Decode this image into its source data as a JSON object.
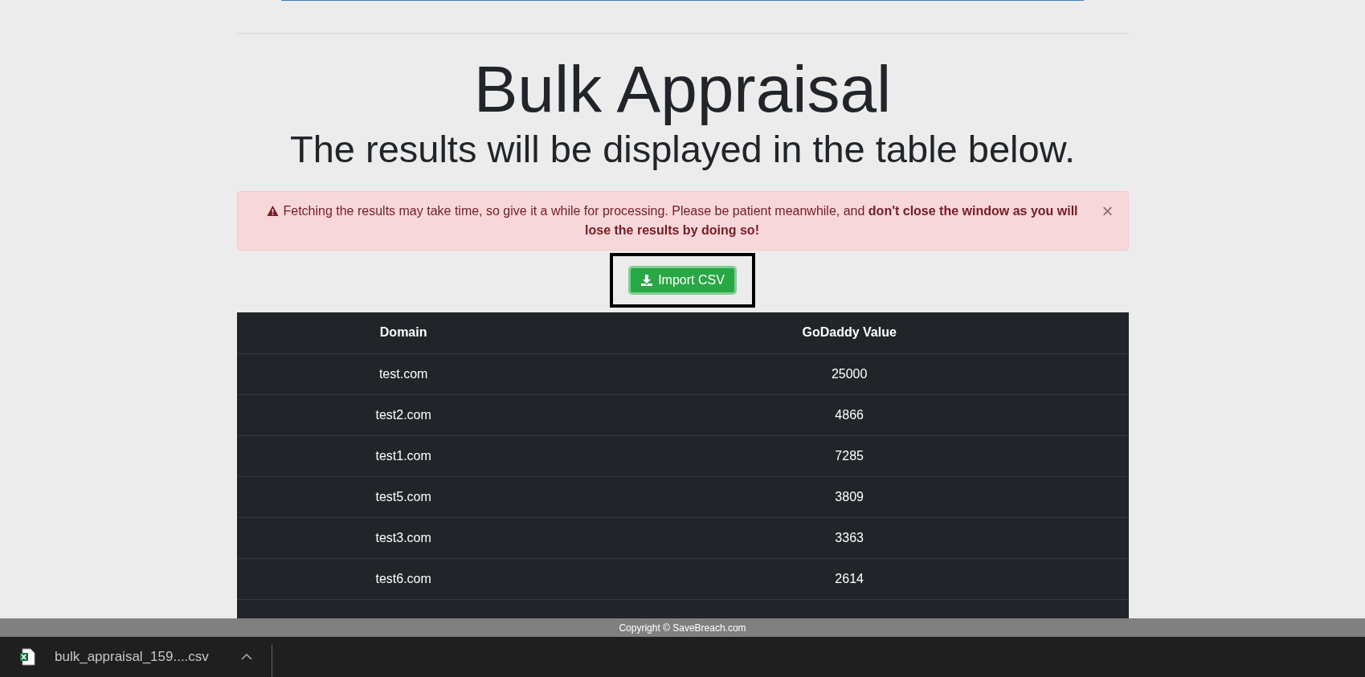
{
  "heading": {
    "title": "Bulk Appraisal",
    "subtitle": "The results will be displayed in the table below."
  },
  "alert": {
    "text": "Fetching the results may take time, so give it a while for processing. Please be patient meanwhile, and **don't close the window as you will lose the results by doing so!**",
    "close": "×"
  },
  "import_button": {
    "label": "Import CSV",
    "highlighted": true
  },
  "table": {
    "columns": [
      "Domain",
      "GoDaddy Value"
    ],
    "rows": [
      [
        "test.com",
        "25000"
      ],
      [
        "test2.com",
        "4866"
      ],
      [
        "test1.com",
        "7285"
      ],
      [
        "test5.com",
        "3809"
      ],
      [
        "test3.com",
        "3363"
      ],
      [
        "test6.com",
        "2614"
      ]
    ]
  },
  "footer": {
    "text": "Copyright © SaveBreach.com"
  },
  "downloads": [
    {
      "file": "bulk_appraisal_159....csv"
    }
  ]
}
